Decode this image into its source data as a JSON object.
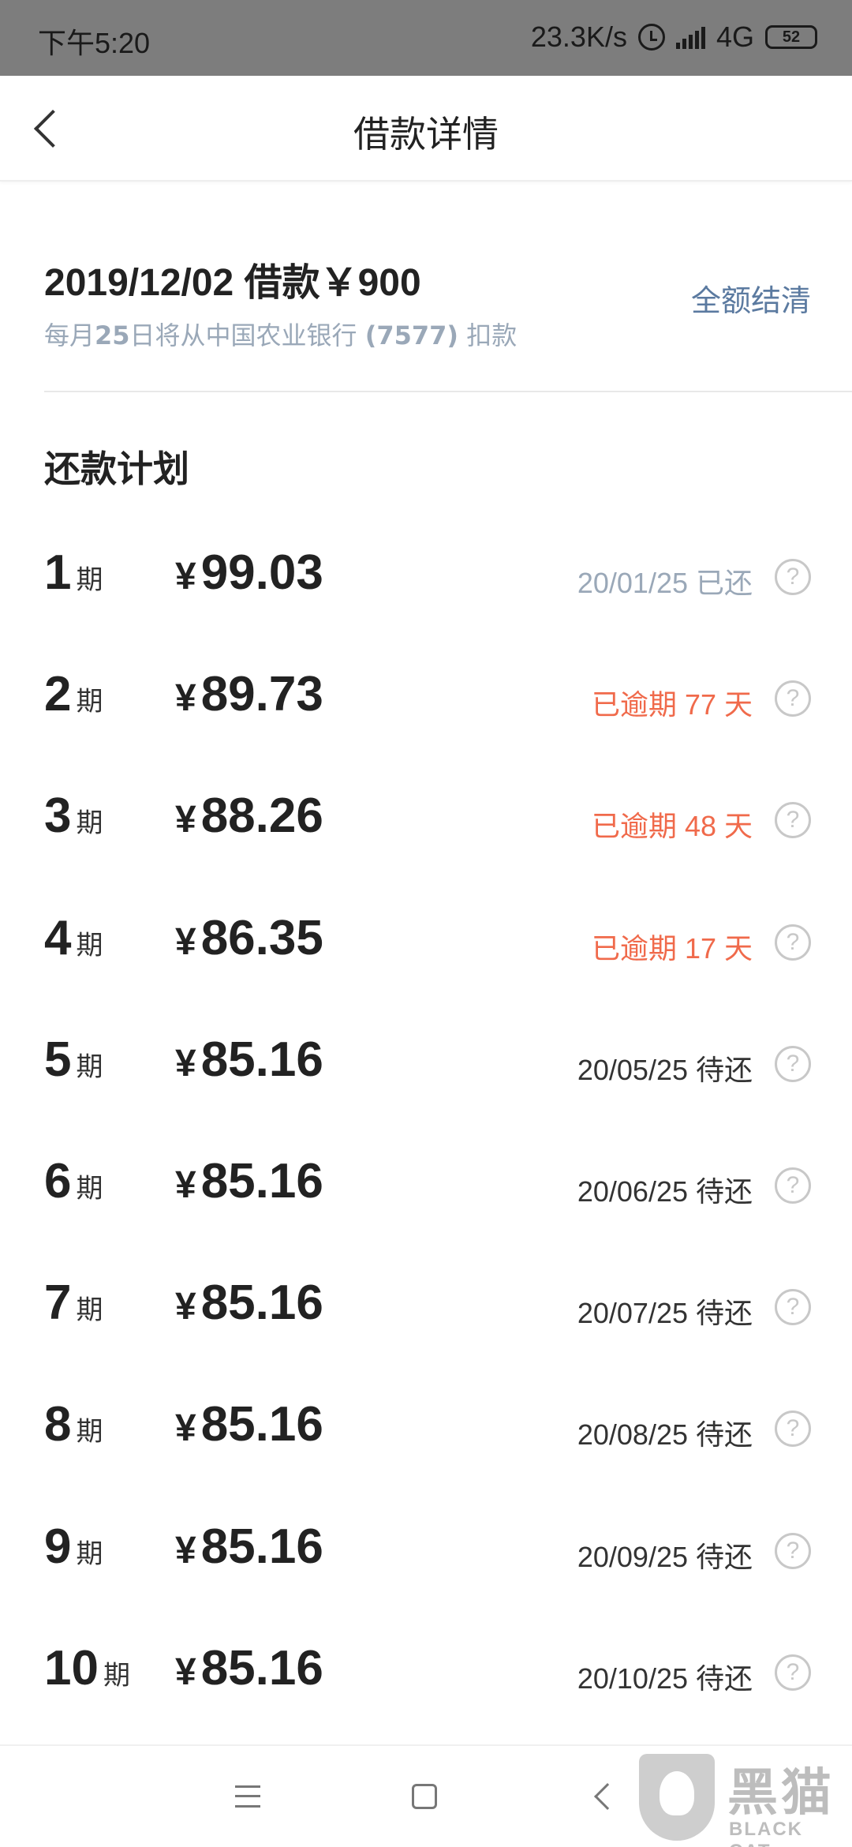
{
  "status_bar": {
    "time": "下午5:20",
    "speed": "23.3K/s",
    "network": "4G",
    "battery": "52"
  },
  "nav": {
    "title": "借款详情"
  },
  "loan": {
    "header": "2019/12/02 借款￥900",
    "sub_prefix": "每月",
    "sub_day": "25",
    "sub_mid": "日将从中国农业银行 ",
    "sub_card": "(7577)",
    "sub_suffix": " 扣款",
    "settle_label": "全额结清"
  },
  "plan": {
    "title": "还款计划",
    "unit": "期",
    "currency": "¥",
    "help_symbol": "?",
    "rows": [
      {
        "period": "1",
        "amount": "99.03",
        "status": "20/01/25 已还",
        "state": "paid"
      },
      {
        "period": "2",
        "amount": "89.73",
        "status": "已逾期 77 天",
        "state": "overdue"
      },
      {
        "period": "3",
        "amount": "88.26",
        "status": "已逾期 48 天",
        "state": "overdue"
      },
      {
        "period": "4",
        "amount": "86.35",
        "status": "已逾期 17 天",
        "state": "overdue"
      },
      {
        "period": "5",
        "amount": "85.16",
        "status": "20/05/25 待还",
        "state": "pending"
      },
      {
        "period": "6",
        "amount": "85.16",
        "status": "20/06/25 待还",
        "state": "pending"
      },
      {
        "period": "7",
        "amount": "85.16",
        "status": "20/07/25 待还",
        "state": "pending"
      },
      {
        "period": "8",
        "amount": "85.16",
        "status": "20/08/25 待还",
        "state": "pending"
      },
      {
        "period": "9",
        "amount": "85.16",
        "status": "20/09/25 待还",
        "state": "pending"
      },
      {
        "period": "10",
        "amount": "85.16",
        "status": "20/10/25 待还",
        "state": "pending"
      }
    ]
  },
  "watermark": {
    "text": "黑猫",
    "sub": "BLACK CAT"
  },
  "icons": {
    "back": "chevron-left-icon",
    "help": "question-circle-icon",
    "menu": "menu-icon",
    "home": "square-home-icon",
    "nav_back": "triangle-back-icon"
  },
  "colors": {
    "overdue": "#f06a4b",
    "paid": "#9aa8b8",
    "link": "#5b7aa0",
    "status_bar": "#7d7d7d"
  }
}
